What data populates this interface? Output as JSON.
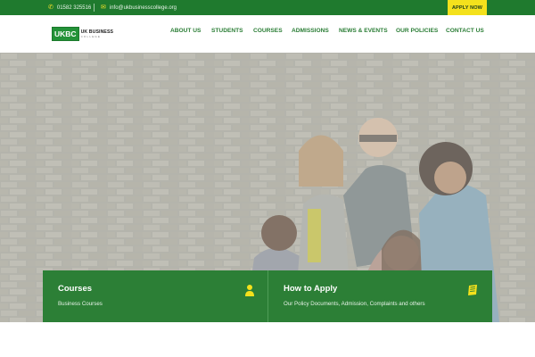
{
  "topbar": {
    "phone": "01582 325516",
    "email": "info@ukbusinesscollege.org",
    "apply_label": "APPLY NOW",
    "icons": {
      "phone": "phone-icon",
      "email": "envelope-icon"
    }
  },
  "logo": {
    "mark": "UKBC",
    "name": "UK BUSINESS",
    "tagline": "COLLEGE"
  },
  "nav": {
    "items": [
      {
        "label": "ABOUT US"
      },
      {
        "label": "STUDENTS"
      },
      {
        "label": "COURSES"
      },
      {
        "label": "ADMISSIONS"
      },
      {
        "label": "NEWS & EVENTS"
      },
      {
        "label": "OUR POLICIES"
      },
      {
        "label": "CONTACT US"
      }
    ]
  },
  "cards": [
    {
      "title": "Courses",
      "desc": "Business Courses",
      "icon": "user-icon"
    },
    {
      "title": "How to Apply",
      "desc": "Our Policy Documents, Admission, Complaints and others",
      "icon": "book-icon"
    }
  ],
  "colors": {
    "primary_green": "#2c7f36",
    "topbar_green": "#1f7a2e",
    "accent_yellow": "#f4e11c",
    "nav_text": "#2a7d35"
  }
}
